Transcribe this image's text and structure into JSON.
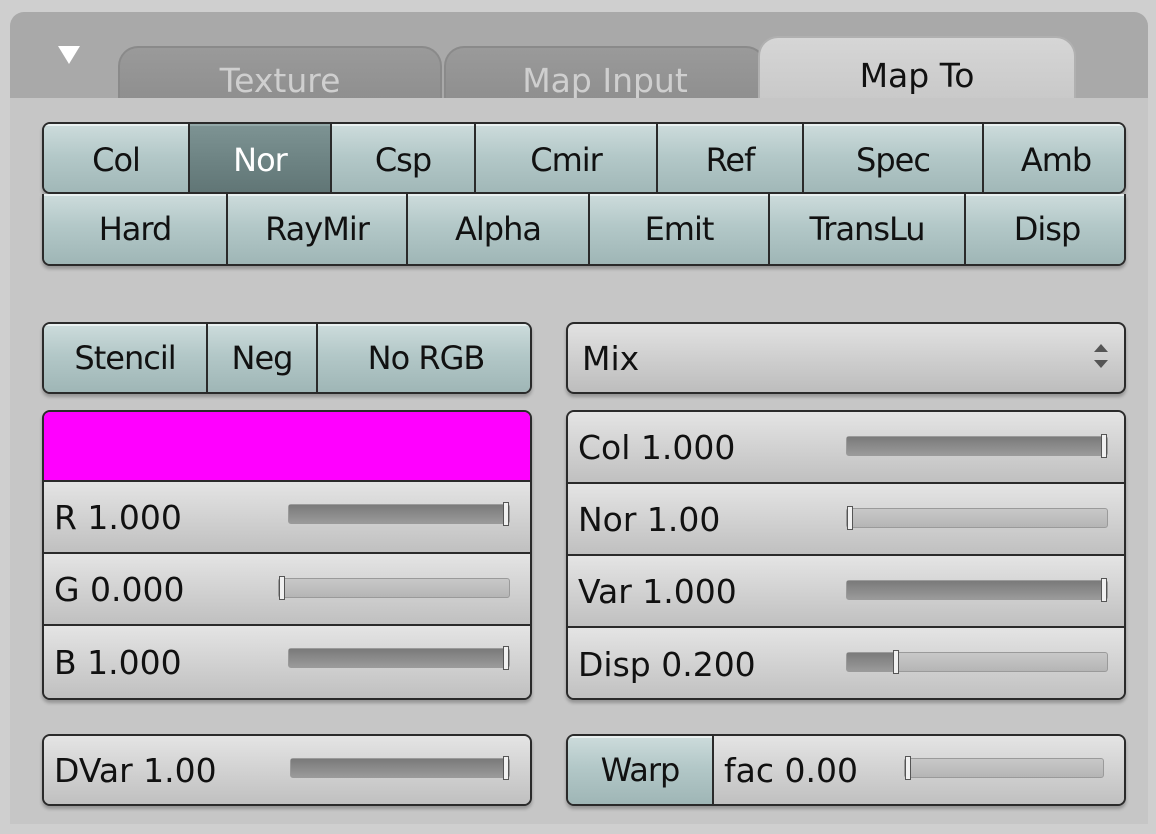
{
  "tabs": [
    {
      "label": "Texture",
      "active": false
    },
    {
      "label": "Map Input",
      "active": false
    },
    {
      "label": "Map To",
      "active": true
    }
  ],
  "map_to_row1": [
    {
      "label": "Col",
      "on": false
    },
    {
      "label": "Nor",
      "on": true
    },
    {
      "label": "Csp",
      "on": false
    },
    {
      "label": "Cmir",
      "on": false
    },
    {
      "label": "Ref",
      "on": false
    },
    {
      "label": "Spec",
      "on": false
    },
    {
      "label": "Amb",
      "on": false
    }
  ],
  "map_to_row2": [
    {
      "label": "Hard",
      "on": false
    },
    {
      "label": "RayMir",
      "on": false
    },
    {
      "label": "Alpha",
      "on": false
    },
    {
      "label": "Emit",
      "on": false
    },
    {
      "label": "TransLu",
      "on": false
    },
    {
      "label": "Disp",
      "on": false
    }
  ],
  "options": [
    {
      "label": "Stencil"
    },
    {
      "label": "Neg"
    },
    {
      "label": "No RGB"
    }
  ],
  "blend_mode": {
    "selected": "Mix"
  },
  "color": {
    "swatch": "#ff00ff",
    "r": {
      "label": "R 1.000",
      "value": 1.0
    },
    "g": {
      "label": "G 0.000",
      "value": 0.0
    },
    "b": {
      "label": "B 1.000",
      "value": 1.0
    }
  },
  "factors": [
    {
      "label": "Col 1.000",
      "value": 1.0
    },
    {
      "label": "Nor 1.00",
      "value": 0.0
    },
    {
      "label": "Var 1.000",
      "value": 1.0
    },
    {
      "label": "Disp 0.200",
      "value": 0.2
    }
  ],
  "dvar": {
    "label": "DVar 1.00",
    "value": 1.0
  },
  "warp": {
    "button": "Warp",
    "fac_label": "fac 0.00",
    "fac_value": 0.0
  },
  "colors": {
    "accent_button": "#b3c8c8",
    "active_button": "#6c8282"
  }
}
